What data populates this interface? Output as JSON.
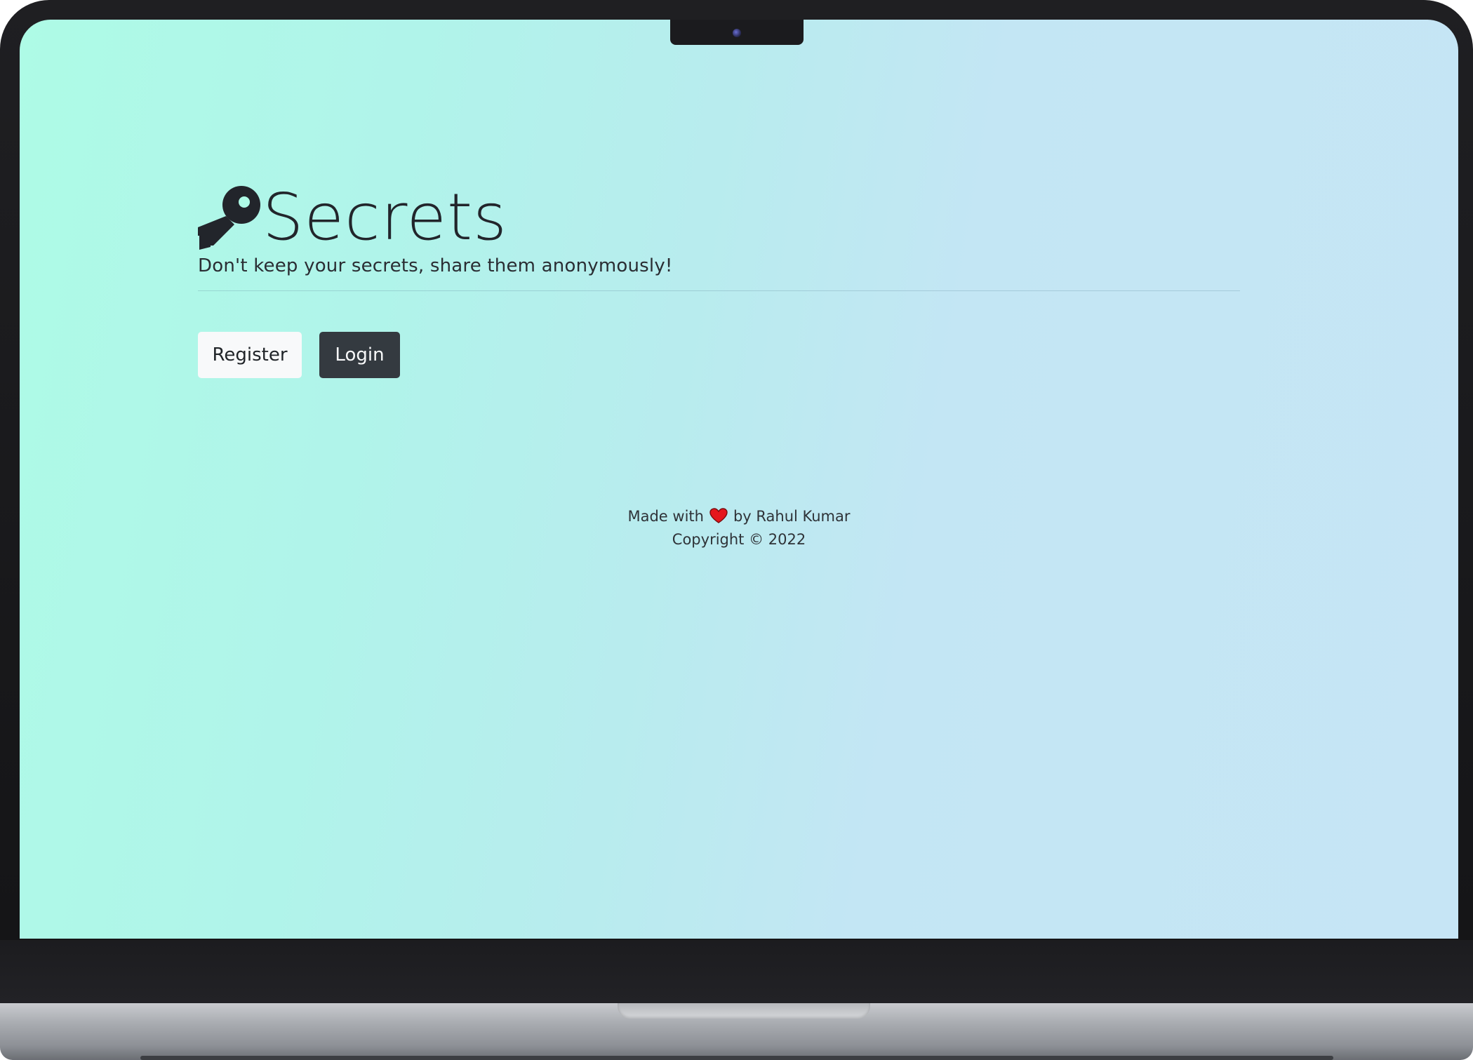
{
  "app": {
    "title": "Secrets",
    "tagline": "Don't keep your secrets, share them anonymously!"
  },
  "actions": {
    "register_label": "Register",
    "login_label": "Login"
  },
  "footer": {
    "made_with": "Made with",
    "by_author": "by Rahul Kumar",
    "copyright": "Copyright © 2022"
  },
  "icons": {
    "brand": "key-icon",
    "footer": "heart-icon"
  },
  "colors": {
    "text": "#22252b",
    "register_bg": "#f8f9fa",
    "login_bg": "#343a40",
    "heart": "#e5171d"
  }
}
